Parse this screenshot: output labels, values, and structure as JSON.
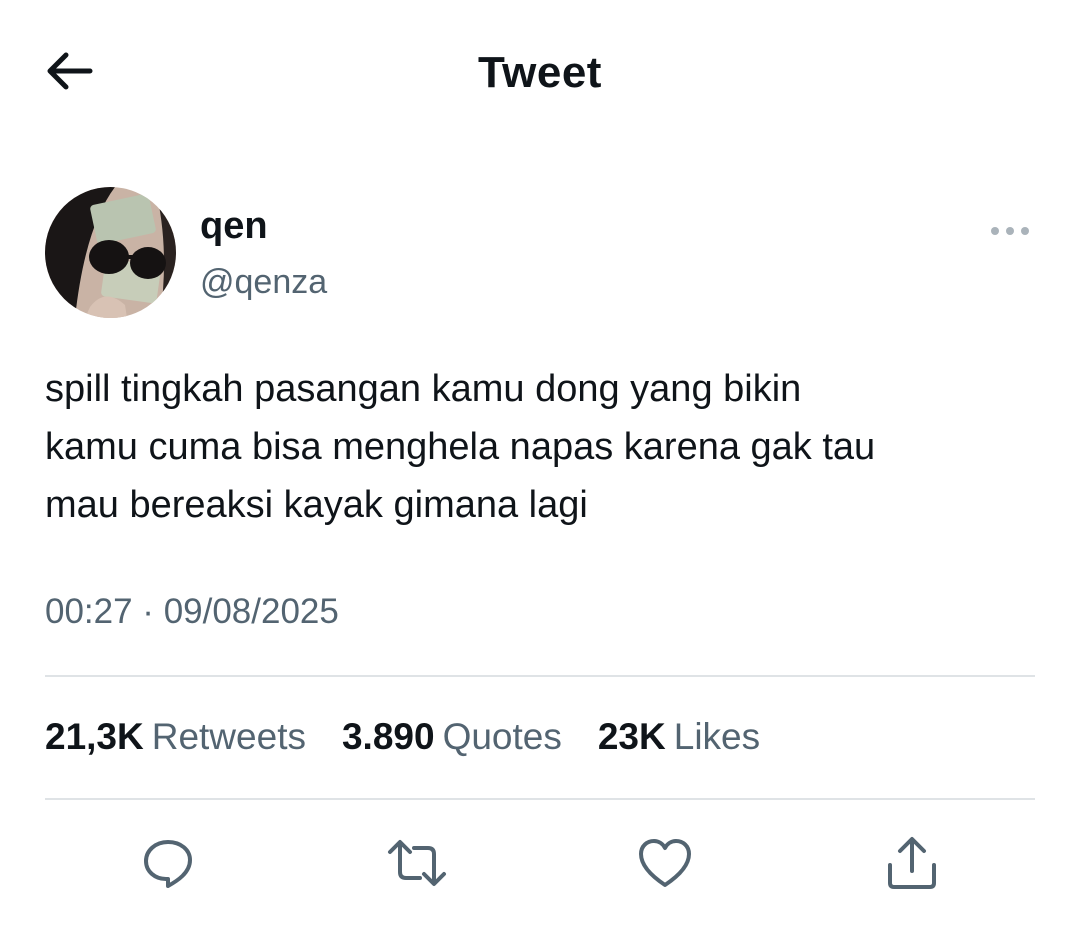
{
  "header": {
    "title": "Tweet",
    "back_icon": "arrow-left-icon"
  },
  "author": {
    "display_name": "qen",
    "handle": "@qenza",
    "avatar_icon": "user-avatar",
    "more_icon": "more-dots-icon"
  },
  "tweet": {
    "text": "spill tingkah pasangan kamu dong yang bikin\nkamu cuma bisa menghela napas karena gak tau\nmau bereaksi kayak gimana lagi",
    "timestamp": "00:27 · 09/08/2025"
  },
  "stats": [
    {
      "count": "21,3K",
      "label": "Retweets"
    },
    {
      "count": "3.890",
      "label": "Quotes"
    },
    {
      "count": "23K",
      "label": "Likes"
    }
  ],
  "actions": [
    {
      "name": "reply",
      "icon": "reply-icon"
    },
    {
      "name": "retweet",
      "icon": "retweet-icon"
    },
    {
      "name": "like",
      "icon": "heart-icon"
    },
    {
      "name": "share",
      "icon": "share-icon"
    }
  ],
  "colors": {
    "text_primary": "#0f1419",
    "text_secondary": "#536471",
    "divider": "#dfe3e6",
    "icon": "#536471"
  }
}
